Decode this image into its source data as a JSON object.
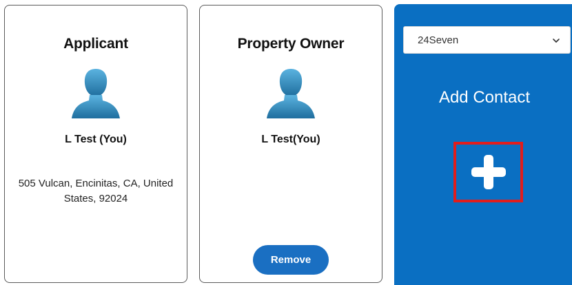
{
  "applicant_card": {
    "title": "Applicant",
    "name": "L Test (You)",
    "address": "505 Vulcan, Encinitas, CA, United States, 92024",
    "icon": "user-avatar-icon"
  },
  "owner_card": {
    "title": "Property Owner",
    "name": "L Test(You)",
    "remove_label": "Remove",
    "icon": "user-avatar-icon"
  },
  "add_contact": {
    "select_value": "24Seven",
    "label": "Add Contact",
    "icon": "plus-icon"
  },
  "colors": {
    "accent": "#0a6fc2",
    "button": "#1a6fc2",
    "highlight": "#e11d1d",
    "card_border": "#5a5a5a"
  }
}
